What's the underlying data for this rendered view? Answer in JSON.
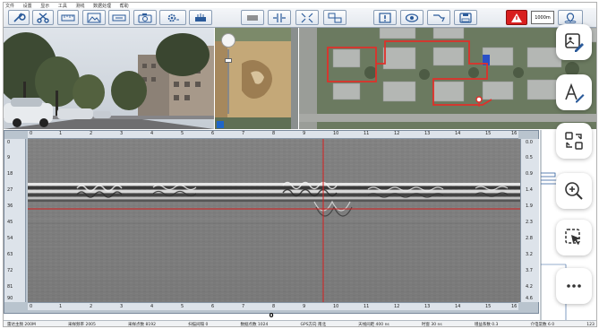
{
  "menu": {
    "items": [
      "文件",
      "设置",
      "显示",
      "工具",
      "测线",
      "数据处理",
      "帮助"
    ]
  },
  "toolbar": {
    "scale_label": "1000m",
    "buttons": [
      {
        "name": "wrench-icon"
      },
      {
        "name": "scissors-icon"
      },
      {
        "name": "ruler-icon"
      },
      {
        "name": "image-icon"
      },
      {
        "name": "calibrate-icon"
      },
      {
        "name": "camera-icon"
      },
      {
        "name": "settings-gear-icon"
      },
      {
        "name": "radar-icon"
      },
      {
        "name": "horizontal-lines-icon"
      },
      {
        "name": "split-vertical-icon"
      },
      {
        "name": "expand-icon"
      },
      {
        "name": "layout-icon"
      },
      {
        "name": "alert-icon"
      },
      {
        "name": "eye-icon"
      },
      {
        "name": "route-icon"
      },
      {
        "name": "save-icon"
      },
      {
        "name": "warning-icon"
      },
      {
        "name": "map-pin-icon"
      }
    ]
  },
  "radar": {
    "top_ticks": [
      "0",
      "1",
      "2",
      "3",
      "4",
      "5",
      "6",
      "7",
      "8",
      "9",
      "10",
      "11",
      "12",
      "13",
      "14",
      "15",
      "16"
    ],
    "left_ticks": [
      "0",
      "9",
      "18",
      "27",
      "36",
      "45",
      "54",
      "63",
      "72",
      "81",
      "90"
    ],
    "right_ticks": [
      "0.0",
      "0.5",
      "0.9",
      "1.4",
      "1.9",
      "2.3",
      "2.8",
      "3.2",
      "3.7",
      "4.2",
      "4.6"
    ],
    "bottom_ticks": [
      "0",
      "1",
      "2",
      "3",
      "4",
      "5",
      "6",
      "7",
      "8",
      "9",
      "10",
      "11",
      "12",
      "13",
      "14",
      "15",
      "16"
    ],
    "position_label": "0"
  },
  "status": {
    "items": [
      "雷达主频 200M",
      "采样频率 2005",
      "采样点数 8192",
      "扫描间隔 0",
      "数据点数 1024",
      "GPS方向 南北",
      "天线间距 400 ns",
      "时窗 30 ns",
      "增益系数 0.3",
      "介电常数 6 0",
      "123"
    ]
  },
  "side_actions": [
    {
      "name": "edit-image-button",
      "icon": "image-edit-icon"
    },
    {
      "name": "edit-text-button",
      "icon": "text-edit-icon"
    },
    {
      "name": "swap-view-button",
      "icon": "swap-icon"
    },
    {
      "name": "zoom-in-button",
      "icon": "zoom-in-icon"
    },
    {
      "name": "select-edit-button",
      "icon": "select-edit-icon"
    },
    {
      "name": "more-button",
      "icon": "more-icon"
    }
  ],
  "colors": {
    "accent": "#2a5a9a",
    "marker_red": "#d81e1e",
    "route_red": "#e0302a"
  }
}
